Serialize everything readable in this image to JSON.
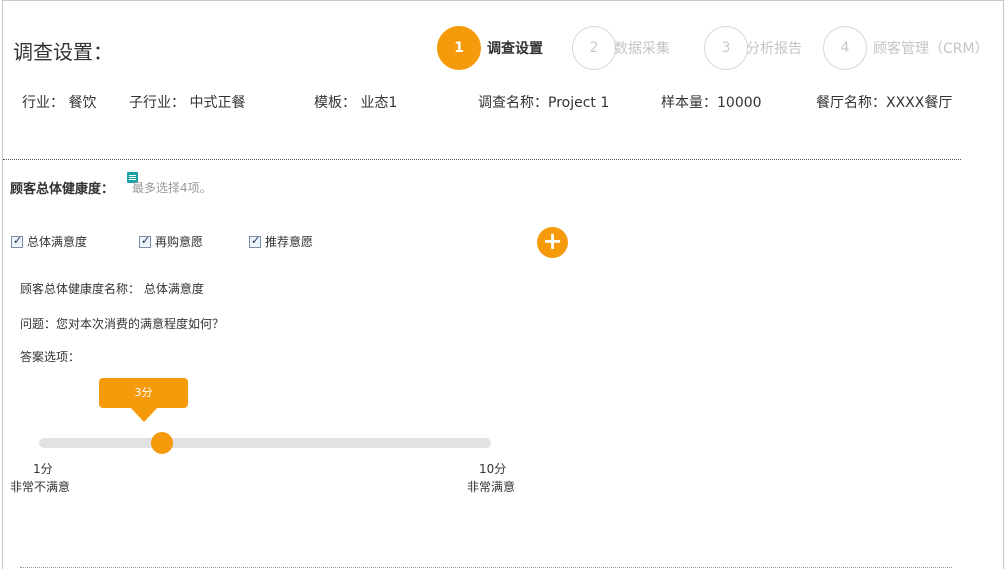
{
  "page_title": "调查设置：",
  "steps": [
    {
      "num": "1",
      "label": "调查设置"
    },
    {
      "num": "2",
      "label": "数据采集"
    },
    {
      "num": "3",
      "label": "分析报告"
    },
    {
      "num": "4",
      "label": "顾客管理（CRM）"
    }
  ],
  "info": {
    "industry": "行业： 餐饮",
    "sub_industry": "子行业： 中式正餐",
    "template": "模板： 业态1",
    "survey_name": "调查名称：Project 1",
    "sample_size": "样本量：10000",
    "restaurant": "餐厅名称：XXXX餐厅"
  },
  "section": {
    "title": "顾客总体健康度：",
    "hint": "最多选择4项。",
    "note_icon": "note-icon"
  },
  "options": [
    {
      "label": "总体满意度",
      "checked": true
    },
    {
      "label": "再购意愿",
      "checked": true
    },
    {
      "label": "推荐意愿",
      "checked": true
    }
  ],
  "add_button": "+",
  "detail": {
    "name": "顾客总体健康度名称：  总体满意度",
    "question": "问题：您对本次消费的满意程度如何？",
    "answers_label": "答案选项："
  },
  "slider": {
    "min": 1,
    "max": 10,
    "value": 3,
    "value_label": "3分",
    "min_label": "1分",
    "min_desc": "非常不满意",
    "max_label": "10分",
    "max_desc": "非常满意"
  },
  "colors": {
    "accent": "#f59a0a",
    "note_icon": "#1ea0a8",
    "track": "#e2e2e2"
  }
}
